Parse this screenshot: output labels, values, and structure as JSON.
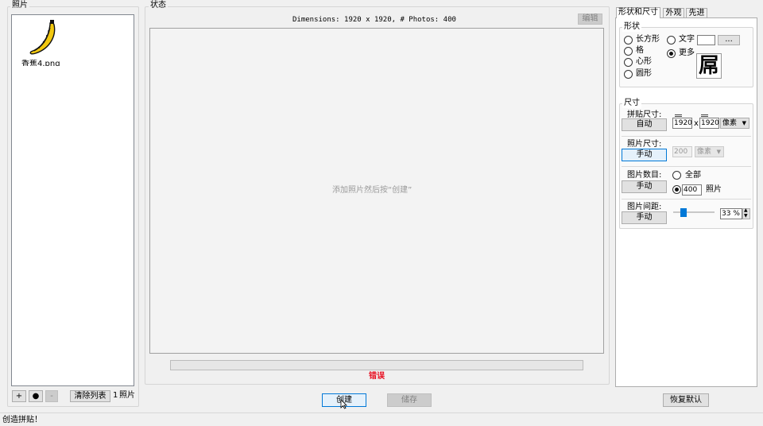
{
  "photos_panel": {
    "legend": "照片",
    "items": [
      {
        "name": "香蕉4.png"
      }
    ],
    "add_label": "+",
    "web_label": "●",
    "remove_label": "-",
    "clear_label": "清除列表",
    "count": "1",
    "count_unit": "照片"
  },
  "status_panel": {
    "legend": "状态",
    "dimensions": "Dimensions: 1920 x 1920, # Photos: 400",
    "edit_label": "编辑",
    "hint": "添加照片然后按“创建”",
    "error": "错误",
    "create_label": "创建",
    "save_label": "储存"
  },
  "tabs": [
    {
      "label": "形状和尺寸",
      "active": true
    },
    {
      "label": "外观",
      "active": false
    },
    {
      "label": "先进",
      "active": false
    }
  ],
  "shape": {
    "legend": "形状",
    "options": [
      "长方形",
      "格",
      "心形",
      "圆形"
    ],
    "text_label": "文字",
    "text_button": "...",
    "more_label": "更多",
    "preview_char": "屌"
  },
  "size": {
    "legend": "尺寸",
    "tile_label": "拼贴尺寸:",
    "tile_mode": "自动",
    "tile_w": "1920",
    "tile_x": "x",
    "tile_h": "1920",
    "tile_unit": "像素",
    "photo_label": "照片尺寸:",
    "photo_mode": "手动",
    "photo_value": "200",
    "photo_unit": "像素",
    "count_label": "图片数目:",
    "count_mode": "手动",
    "count_all": "全部",
    "count_value": "400",
    "count_unit": "照片",
    "spacing_label": "图片间距:",
    "spacing_mode": "手动",
    "spacing_value": "33 %",
    "spacing_level": 0.2
  },
  "reset_label": "恢复默认",
  "statusbar": "创造拼贴！",
  "colors": {
    "accent": "#0078d7",
    "error": "#e81123"
  }
}
